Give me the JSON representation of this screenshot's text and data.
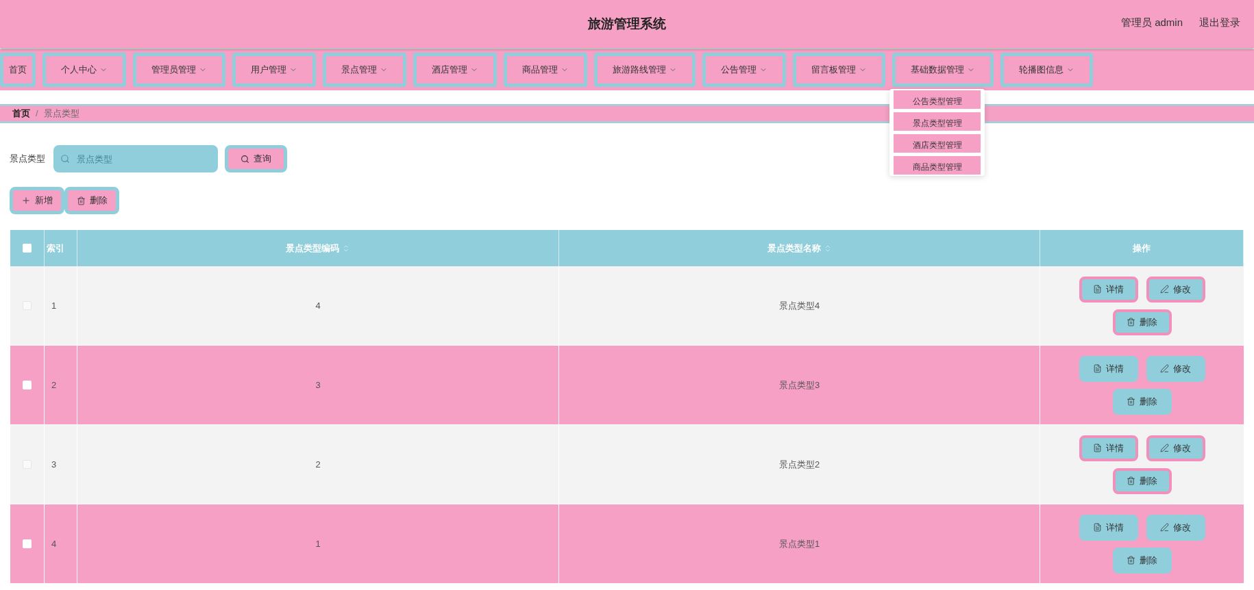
{
  "header": {
    "title": "旅游管理系统",
    "user": "管理员 admin",
    "logout": "退出登录"
  },
  "nav": [
    {
      "label": "首页",
      "has_menu": false
    },
    {
      "label": "个人中心",
      "has_menu": true
    },
    {
      "label": "管理员管理",
      "has_menu": true
    },
    {
      "label": "用户管理",
      "has_menu": true
    },
    {
      "label": "景点管理",
      "has_menu": true
    },
    {
      "label": "酒店管理",
      "has_menu": true
    },
    {
      "label": "商品管理",
      "has_menu": true
    },
    {
      "label": "旅游路线管理",
      "has_menu": true
    },
    {
      "label": "公告管理",
      "has_menu": true
    },
    {
      "label": "留言板管理",
      "has_menu": true
    },
    {
      "label": "基础数据管理",
      "has_menu": true,
      "menu": [
        "公告类型管理",
        "景点类型管理",
        "酒店类型管理",
        "商品类型管理"
      ]
    },
    {
      "label": "轮播图信息",
      "has_menu": true
    }
  ],
  "breadcrumb": {
    "separator": "/",
    "items": [
      "首页",
      "景点类型"
    ]
  },
  "search": {
    "label": "景点类型",
    "placeholder": "景点类型",
    "button": "查询"
  },
  "toolbar": [
    {
      "kind": "add",
      "label": "新增"
    },
    {
      "kind": "delete",
      "label": "删除"
    }
  ],
  "table": {
    "all_selected": false,
    "columns": [
      {
        "label": "索引",
        "sortable": false
      },
      {
        "label": "景点类型编码",
        "sortable": true
      },
      {
        "label": "景点类型名称",
        "sortable": true
      },
      {
        "label": "操作",
        "sortable": false
      }
    ],
    "rows": [
      {
        "index": "1",
        "code": "4",
        "name": "景点类型4",
        "selected": false,
        "highlighted": false,
        "actions": [
          {
            "kind": "detail",
            "label": "详情"
          },
          {
            "kind": "edit",
            "label": "修改"
          },
          {
            "kind": "delete",
            "label": "删除"
          }
        ]
      },
      {
        "index": "2",
        "code": "3",
        "name": "景点类型3",
        "selected": false,
        "highlighted": true,
        "actions": [
          {
            "kind": "detail",
            "label": "详情"
          },
          {
            "kind": "edit",
            "label": "修改"
          },
          {
            "kind": "delete",
            "label": "删除"
          }
        ]
      },
      {
        "index": "3",
        "code": "2",
        "name": "景点类型2",
        "selected": false,
        "highlighted": false,
        "actions": [
          {
            "kind": "detail",
            "label": "详情"
          },
          {
            "kind": "edit",
            "label": "修改"
          },
          {
            "kind": "delete",
            "label": "删除"
          }
        ]
      },
      {
        "index": "4",
        "code": "1",
        "name": "景点类型1",
        "selected": false,
        "highlighted": true,
        "actions": [
          {
            "kind": "detail",
            "label": "详情"
          },
          {
            "kind": "edit",
            "label": "修改"
          },
          {
            "kind": "delete",
            "label": "删除"
          }
        ]
      }
    ]
  }
}
